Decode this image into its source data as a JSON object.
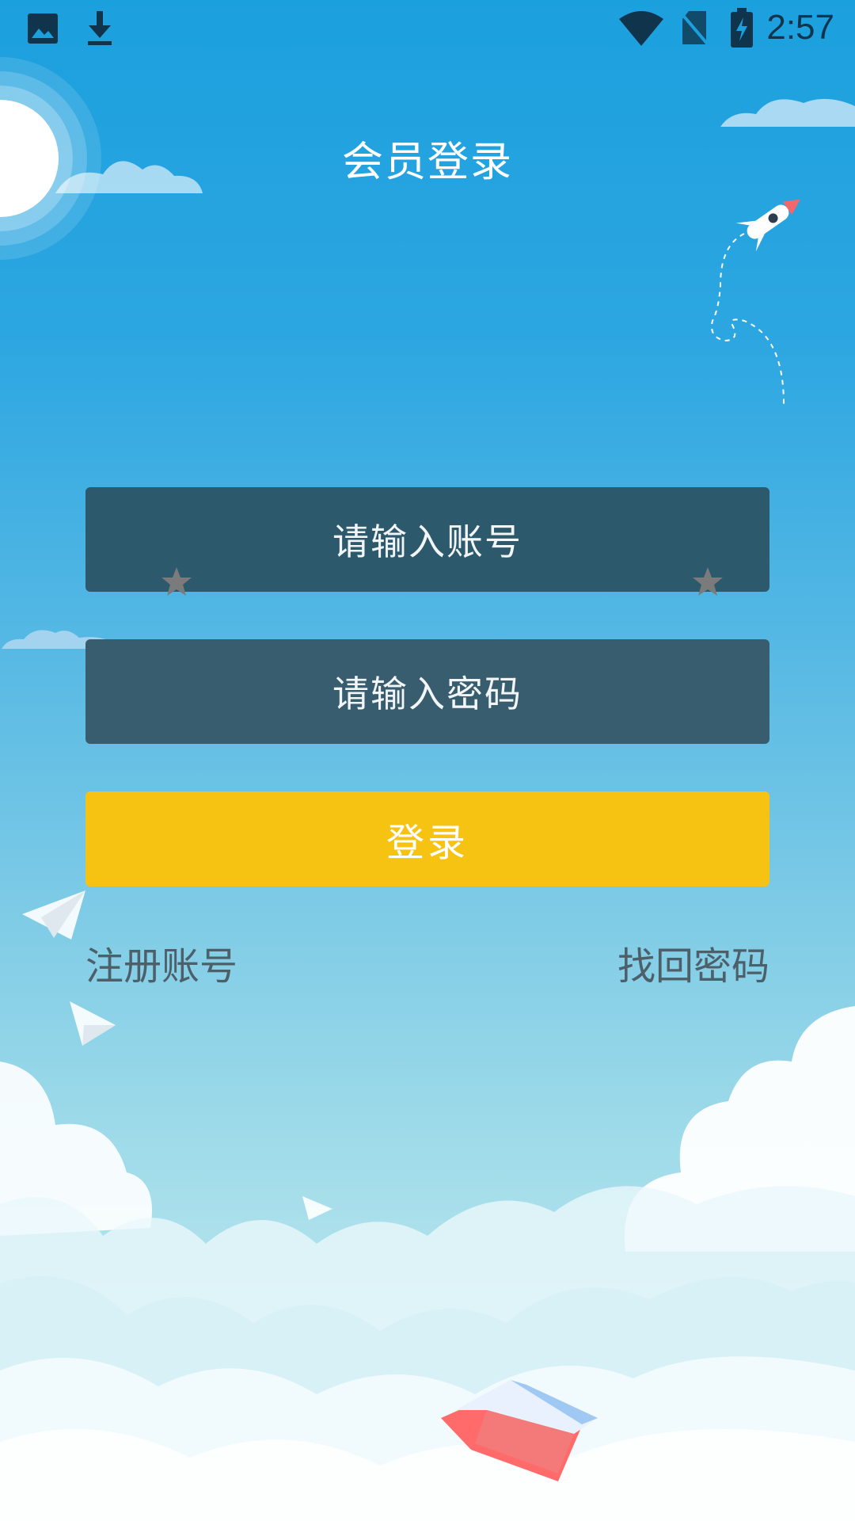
{
  "status_bar": {
    "time": "2:57",
    "icons": [
      "image-icon",
      "download-icon",
      "wifi-icon",
      "no-sim-icon",
      "battery-charging-icon"
    ]
  },
  "header": {
    "title": "会员登录"
  },
  "form": {
    "account_placeholder": "请输入账号",
    "password_placeholder": "请输入密码",
    "login_label": "登录"
  },
  "links": {
    "register": "注册账号",
    "forgot_password": "找回密码"
  },
  "colors": {
    "sky_top": "#1ba0de",
    "sky_bottom": "#c6ebf1",
    "input_bg": "#2c596c",
    "login_button": "#f7c312",
    "link_text": "#4d5f68"
  }
}
